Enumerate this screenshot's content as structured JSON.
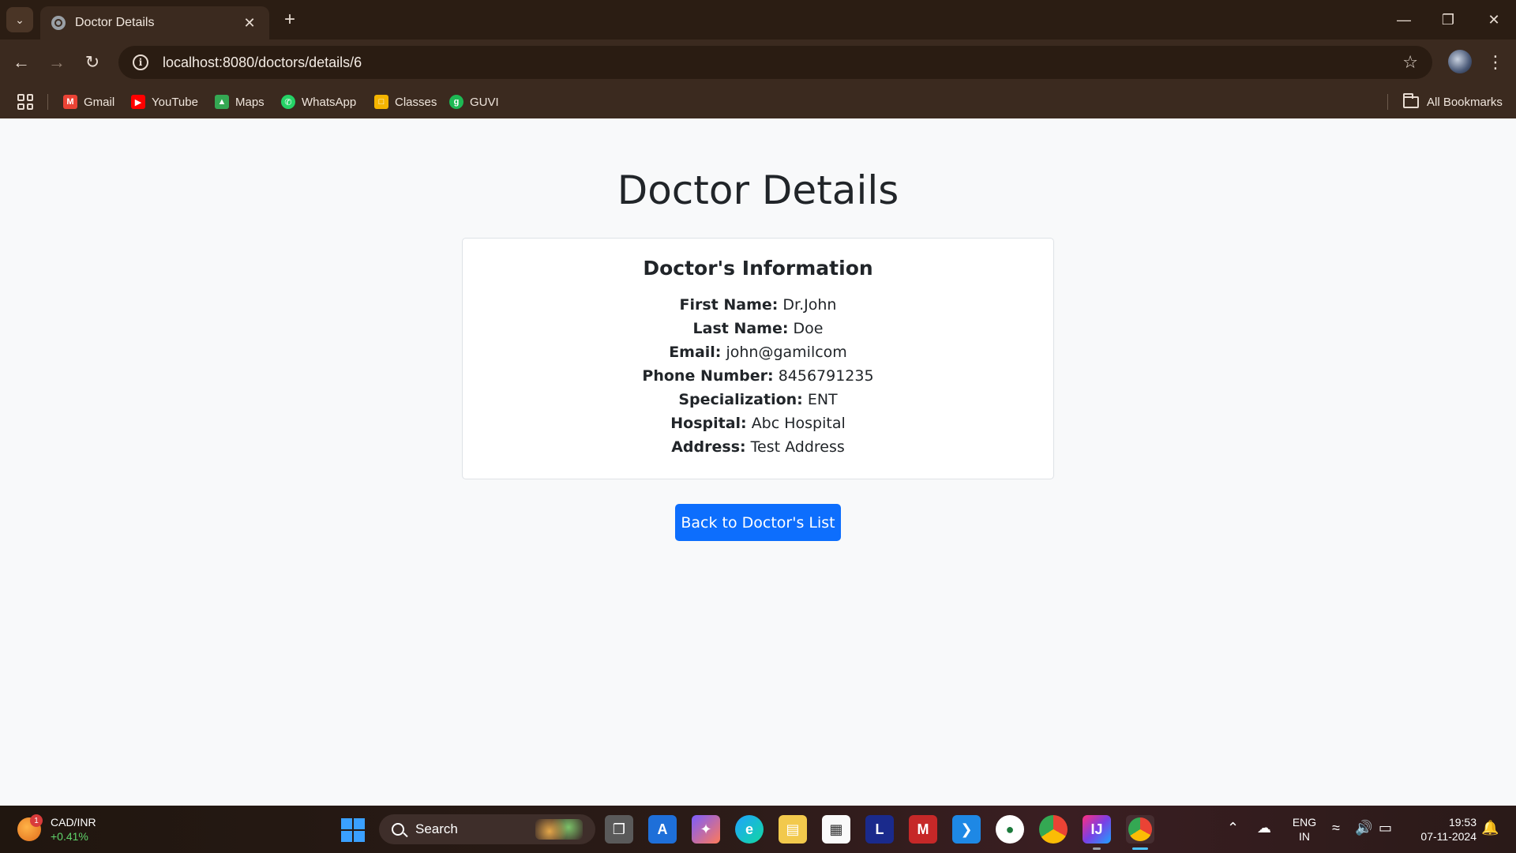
{
  "browser": {
    "tab_title": "Doctor Details",
    "url": "localhost:8080/doctors/details/6",
    "bookmarks": [
      {
        "label": "Gmail",
        "icon": "gmail-icon",
        "color": "#ea4335"
      },
      {
        "label": "YouTube",
        "icon": "youtube-icon",
        "color": "#ff0000"
      },
      {
        "label": "Maps",
        "icon": "maps-icon",
        "color": "#34a853"
      },
      {
        "label": "WhatsApp",
        "icon": "whatsapp-icon",
        "color": "#25d366"
      },
      {
        "label": "Classes",
        "icon": "classes-icon",
        "color": "#f4b400"
      },
      {
        "label": "GUVI",
        "icon": "guvi-icon",
        "color": "#1db954"
      }
    ],
    "all_bookmarks_label": "All Bookmarks"
  },
  "page": {
    "title": "Doctor Details",
    "card_title": "Doctor's Information",
    "fields": [
      {
        "label": "First Name:",
        "value": "Dr.John"
      },
      {
        "label": "Last Name:",
        "value": "Doe"
      },
      {
        "label": "Email:",
        "value": "john@gamilcom"
      },
      {
        "label": "Phone Number:",
        "value": "8456791235"
      },
      {
        "label": "Specialization:",
        "value": "ENT"
      },
      {
        "label": "Hospital:",
        "value": "Abc Hospital"
      },
      {
        "label": "Address:",
        "value": "Test Address"
      }
    ],
    "back_button": "Back to Doctor's List",
    "accent_color": "#0d6efd"
  },
  "taskbar": {
    "weather_badge": "1",
    "ticker": "CAD/INR",
    "ticker_change": "+0.41%",
    "search_label": "Search",
    "lang_top": "ENG",
    "lang_bottom": "IN",
    "time": "19:53",
    "date": "07-11-2024"
  }
}
